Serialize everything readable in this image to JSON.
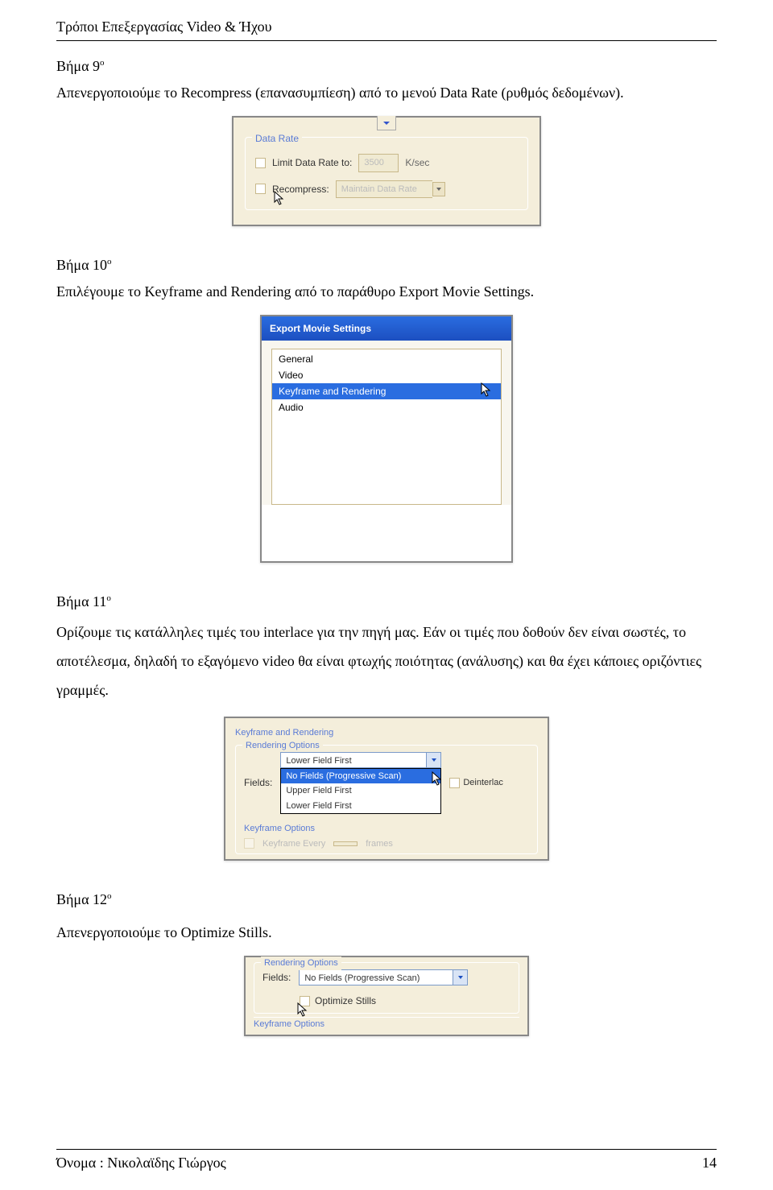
{
  "header": {
    "title": "Τρόποι Επεξεργασίας Video & Ήχου"
  },
  "step9": {
    "label": "Βήμα 9",
    "sup": "ο",
    "desc": "Απενεργοποιούμε το Recompress (επανασυμπίεση) από το μενού Data Rate (ρυθμός δεδομένων)."
  },
  "fig1": {
    "group": "Data Rate",
    "limit_label": "Limit Data Rate to:",
    "limit_value": "3500",
    "limit_unit": "K/sec",
    "recompress_label": "Recompress:",
    "recompress_value": "Maintain Data Rate"
  },
  "step10": {
    "label": "Βήμα 10",
    "sup": "ο",
    "desc": "Επιλέγουμε το Keyframe and Rendering από το παράθυρο Export Movie Settings."
  },
  "fig2": {
    "title": "Export Movie Settings",
    "items": [
      "General",
      "Video",
      "Keyframe and Rendering",
      "Audio"
    ]
  },
  "step11": {
    "label": "Βήμα 11",
    "sup": "ο",
    "desc": "Ορίζουμε τις κατάλληλες τιμές του interlace για την πηγή μας. Εάν οι τιμές που δοθούν δεν είναι σωστές, το αποτέλεσμα, δηλαδή το εξαγόμενο video θα είναι φτωχής ποιότητας (ανάλυσης) και θα έχει κάποιες οριζόντιες γραμμές."
  },
  "fig3": {
    "panel_label": "Keyframe and Rendering",
    "group": "Rendering Options",
    "fields_label": "Fields:",
    "selected": "Lower Field First",
    "options": [
      "No Fields (Progressive Scan)",
      "Upper Field First",
      "Lower Field First"
    ],
    "deinterlace": "Deinterlac",
    "keyframe_group": "Keyframe Options",
    "kf_every": "Keyframe Every",
    "kf_frames": "frames"
  },
  "step12": {
    "label": "Βήμα 12",
    "sup": "ο",
    "desc": "Απενεργοποιούμε το Optimize Stills."
  },
  "fig4": {
    "group": "Rendering Options",
    "fields_label": "Fields:",
    "selected": "No Fields (Progressive Scan)",
    "optimize": "Optimize Stills",
    "keyframe_group": "Keyframe Options"
  },
  "footer": {
    "author": "Όνομα : Νικολαϊδης Γιώργος",
    "page": "14"
  }
}
